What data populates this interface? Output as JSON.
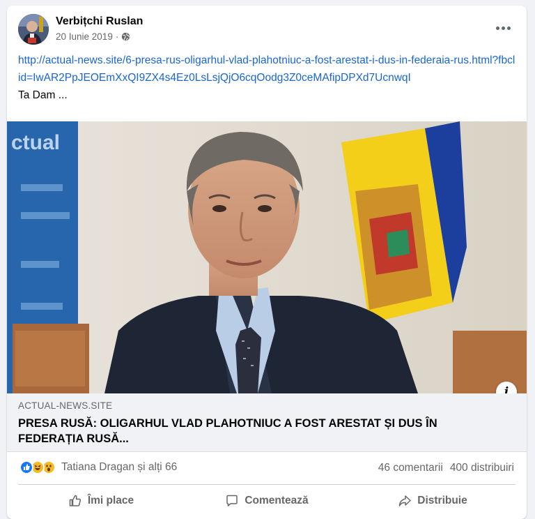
{
  "post": {
    "author": "Verbițchi Ruslan",
    "date": "20 Iunie 2019",
    "separator": "·",
    "privacy_icon": "globe-icon",
    "link_text": "http://actual-news.site/6-presa-rus-oligarhul-vlad-plahotniuc-a-fost-arestat-i-dus-in-federaia-rus.html?fbclid=IwAR2PpJEOEmXxQI9ZX4s4Ez0LsLsjQjO6cqOodg3Z0ceMAfipDPXd7UcnwqI",
    "body_text": "Ta Dam ...",
    "image_alt": "Photo of a man in a suit speaking, Moldovan flag in background"
  },
  "preview": {
    "domain": "ACTUAL-NEWS.SITE",
    "headline": "PRESA RUSĂ: OLIGARHUL VLAD PLAHOTNIUC A FOST ARESTAT ȘI DUS ÎN FEDERAȚIA RUSĂ...",
    "info_glyph": "i"
  },
  "stats": {
    "reaction_icons": [
      "like-icon",
      "haha-icon",
      "wow-icon"
    ],
    "reactors": "Tatiana Dragan și alți 66",
    "comments": "46 comentarii",
    "shares": "400 distribuiri"
  },
  "actions": {
    "like_label": "Îmi place",
    "comment_label": "Comentează",
    "share_label": "Distribuie"
  },
  "colors": {
    "link": "#1a66d6",
    "secondary_text": "#65676b",
    "like_blue": "#1877f2",
    "reaction_yellow": "#f7b928"
  }
}
